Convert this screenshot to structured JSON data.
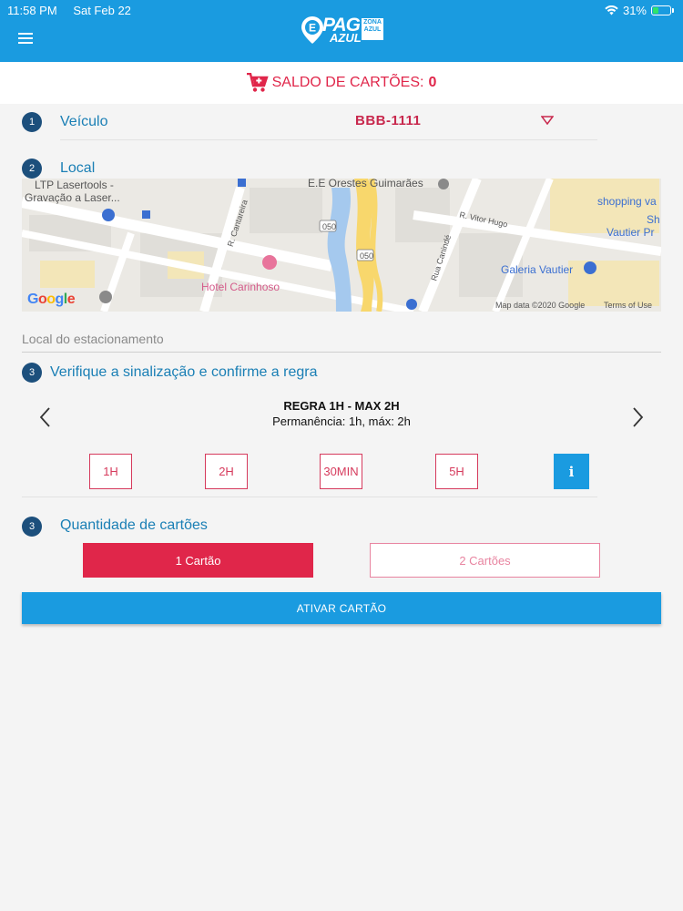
{
  "status_bar": {
    "time": "11:58 PM",
    "date": "Sat Feb 22",
    "battery": "31%"
  },
  "header": {
    "logo_pag": "PAG",
    "logo_azul": "AZUL",
    "logo_zona": "ZONA AZUL"
  },
  "balance": {
    "label": "SALDO DE CARTÕES:",
    "value": "0"
  },
  "vehicle": {
    "step": "1",
    "title": "Veículo",
    "plate": "BBB-1111"
  },
  "location": {
    "step": "2",
    "title": "Local",
    "placeholder": "Local do estacionamento",
    "map": {
      "labels": {
        "ltp1": "LTP Lasertools -",
        "ltp2": "Gravação a Laser...",
        "school": "E.E Orestes Guimarães",
        "shopping": "shopping va",
        "sh": "Sh",
        "vautier_pr": "Vautier Pr",
        "vitor_hugo": "R. Vitor Hugo",
        "cantareira": "R. Cantareira",
        "caninde": "Rua Canindé",
        "hotel": "Hotel Carinhoso",
        "galeria": "Galeria Vautier",
        "road_050_a": "050",
        "road_050_b": "050",
        "google": "Google",
        "mapdata": "Map data ©2020 Google",
        "terms": "Terms of Use"
      }
    }
  },
  "rule": {
    "step": "3",
    "title": "Verifique a sinalização e confirme a regra",
    "rule_name": "REGRA 1H - MAX 2H",
    "rule_desc": "Permanência: 1h, máx: 2h",
    "options": [
      "1H",
      "2H",
      "30MIN",
      "5H"
    ],
    "info_label": "i"
  },
  "quantity": {
    "step": "3",
    "title": "Quantidade de cartões",
    "options": [
      "1 Cartão",
      "2 Cartões"
    ]
  },
  "activate": {
    "label": "ATIVAR CARTÃO"
  },
  "colors": {
    "primary_blue": "#1a9be0",
    "accent_red": "#e0264a",
    "step_navy": "#1c4f7c"
  }
}
